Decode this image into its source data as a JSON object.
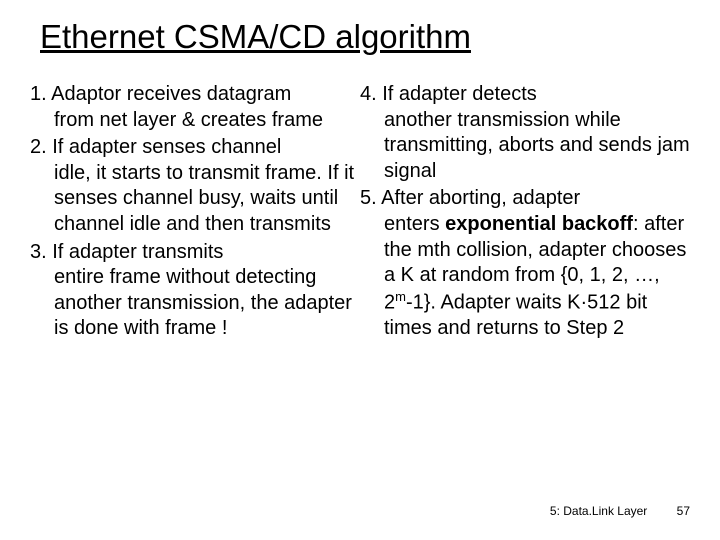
{
  "title": "Ethernet CSMA/CD algorithm",
  "left": {
    "items": [
      {
        "num": "1.",
        "first": "Adaptor receives datagram",
        "rest": "from net layer & creates frame"
      },
      {
        "num": "2.",
        "first": "If adapter senses channel",
        "rest": "idle, it starts to transmit frame. If it senses channel busy, waits until channel idle and then transmits"
      },
      {
        "num": "3.",
        "first": "If adapter transmits",
        "rest": "entire frame without detecting another transmission, the adapter is done with frame !"
      }
    ]
  },
  "right": {
    "items": [
      {
        "num": "4.",
        "first": "If adapter detects",
        "rest": "another transmission while transmitting,  aborts and sends jam signal"
      },
      {
        "num": "5.",
        "first": "After aborting, adapter",
        "rest_pre": "enters ",
        "bold": "exponential backoff",
        "rest_mid": ": after the mth collision, adapter chooses a K at random from {0, 1, 2, …, 2",
        "sup": "m",
        "rest_post": "-1}. Adapter waits K·512 bit times and returns to Step 2"
      }
    ]
  },
  "footer": {
    "label": "5: Data.Link Layer",
    "page": "57"
  }
}
